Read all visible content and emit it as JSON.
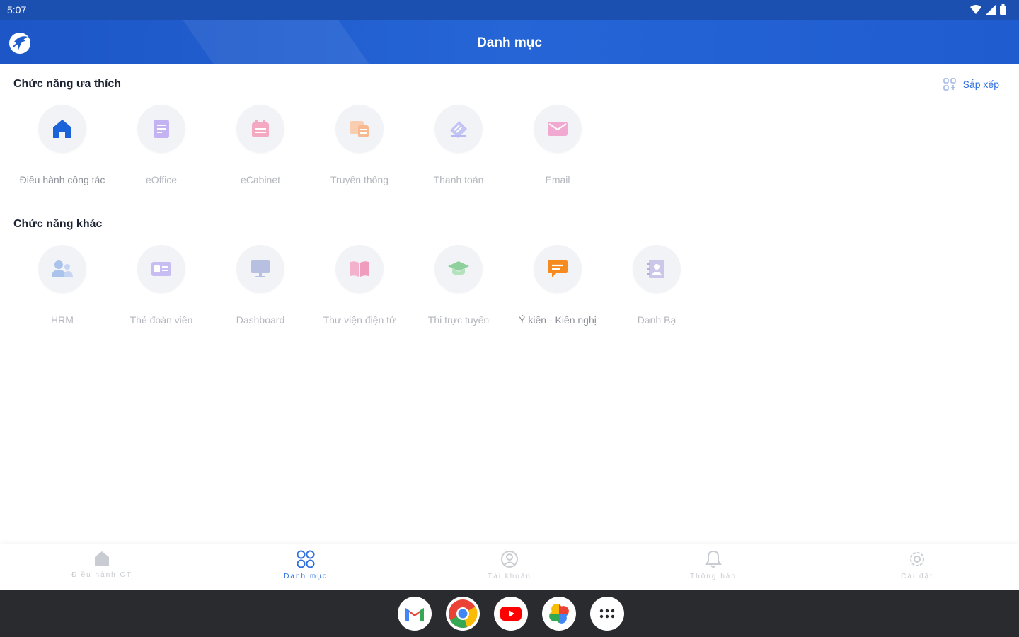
{
  "status": {
    "time": "5:07"
  },
  "appbar": {
    "title": "Danh mục"
  },
  "favorites": {
    "title": "Chức năng ưa thích",
    "sort_label": "Sắp xếp",
    "items": [
      {
        "label": "Điều hành công tác",
        "icon": "home-icon",
        "color": "#1a63d8"
      },
      {
        "label": "eOffice",
        "icon": "document-icon",
        "color": "#b9a6f0"
      },
      {
        "label": "eCabinet",
        "icon": "calendar-icon",
        "color": "#f2a1bd"
      },
      {
        "label": "Truyền thông",
        "icon": "media-icon",
        "color": "#f7c7a2"
      },
      {
        "label": "Thanh toán",
        "icon": "payment-icon",
        "color": "#b7b9f2"
      },
      {
        "label": "Email",
        "icon": "email-icon",
        "color": "#f0a6cf"
      }
    ]
  },
  "others": {
    "title": "Chức năng khác",
    "items": [
      {
        "label": "HRM",
        "icon": "users-icon",
        "color": "#9fbbe8"
      },
      {
        "label": "Thẻ đoàn viên",
        "icon": "id-card-icon",
        "color": "#c0b6ef"
      },
      {
        "label": "Dashboard",
        "icon": "monitor-icon",
        "color": "#aeb6d8"
      },
      {
        "label": "Thư viện điện tử",
        "icon": "book-icon",
        "color": "#f2a9c6"
      },
      {
        "label": "Thi trực tuyến",
        "icon": "graduation-cap-icon",
        "color": "#9ad7a6"
      },
      {
        "label": "Ý kiến - Kiến nghị",
        "icon": "feedback-icon",
        "color": "#f58a1f"
      },
      {
        "label": "Danh Bạ",
        "icon": "contacts-book-icon",
        "color": "#c7c2e8"
      }
    ]
  },
  "bottomnav": {
    "items": [
      {
        "label": "Điều hành CT",
        "icon": "home-icon",
        "active": false
      },
      {
        "label": "Danh mục",
        "icon": "grid-icon",
        "active": true
      },
      {
        "label": "Tài khoản",
        "icon": "account-icon",
        "active": false
      },
      {
        "label": "Thông báo",
        "icon": "bell-icon",
        "active": false
      },
      {
        "label": "Cài đặt",
        "icon": "settings-icon",
        "active": false
      }
    ]
  },
  "dock": {
    "apps": [
      "gmail-icon",
      "chrome-icon",
      "youtube-icon",
      "photos-icon",
      "app-drawer-icon"
    ]
  },
  "colors": {
    "primary": "#1f5cd0",
    "accent": "#2f6fe0"
  }
}
